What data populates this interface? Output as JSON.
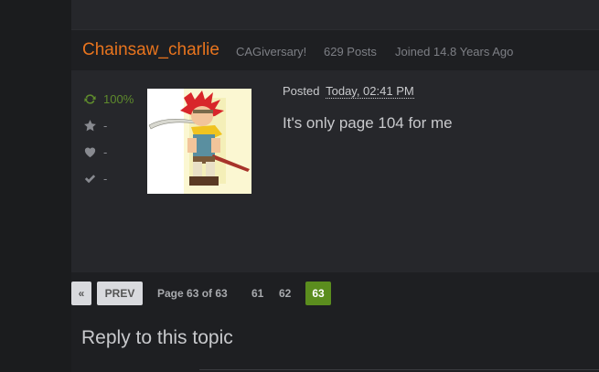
{
  "post": {
    "username": "Chainsaw_charlie",
    "tag": "CAGiversary!",
    "posts": "629 Posts",
    "joined": "Joined 14.8 Years Ago",
    "stats": {
      "rating": "100%",
      "likes": "-",
      "hearts": "-",
      "checks": "-"
    },
    "posted_label": "Posted",
    "timestamp": "Today, 02:41 PM",
    "message": "It's only page 104 for me"
  },
  "pagination": {
    "first_label": "«",
    "prev_label": "PREV",
    "page_info": "Page 63 of 63",
    "pages": [
      "61",
      "62",
      "63"
    ],
    "current": "63"
  },
  "reply": {
    "heading": "Reply to this topic"
  },
  "colors": {
    "username": "#e8741e",
    "rating": "#5e8a2c",
    "current_page": "#5b8d1e"
  },
  "icons": {
    "rating": "refresh-icon",
    "likes": "star-icon",
    "hearts": "heart-icon",
    "checks": "check-icon"
  }
}
